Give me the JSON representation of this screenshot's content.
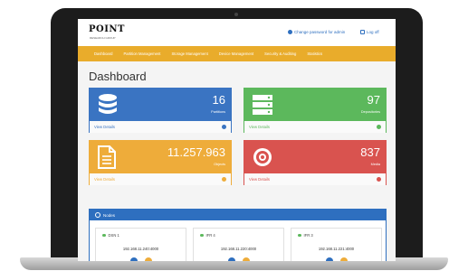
{
  "header": {
    "logo_text": "POINT",
    "logo_sub": "RESEARCH GROUP",
    "change_password": "Change password for admin",
    "logout": "Log off"
  },
  "nav": [
    "Dashboard",
    "Partition Management",
    "Storage Management",
    "Device Management",
    "Security & Auditing",
    "Statistics"
  ],
  "page": {
    "title": "Dashboard"
  },
  "cards": [
    {
      "value": "16",
      "label": "Partitions",
      "footer": "View Details",
      "color": "#3a74c2",
      "icon": "database-icon"
    },
    {
      "value": "97",
      "label": "Depositories",
      "footer": "View Details",
      "color": "#5cb85c",
      "icon": "server-icon"
    },
    {
      "value": "11.257.963",
      "label": "Objects",
      "footer": "View Details",
      "color": "#eeac3a",
      "icon": "document-icon"
    },
    {
      "value": "837",
      "label": "Media",
      "footer": "View Details",
      "color": "#d9534f",
      "icon": "target-icon"
    }
  ],
  "nodes_panel": {
    "title": "Nodes"
  },
  "nodes": [
    {
      "name": "DSN 1",
      "ip": "192.168.11.240:4000",
      "status_color": "#5cb85c"
    },
    {
      "name": "IFR 4",
      "ip": "192.168.11.220:4000",
      "status_color": "#5cb85c"
    },
    {
      "name": "IFR 3",
      "ip": "192.168.11.221:4000",
      "status_color": "#5cb85c"
    }
  ]
}
